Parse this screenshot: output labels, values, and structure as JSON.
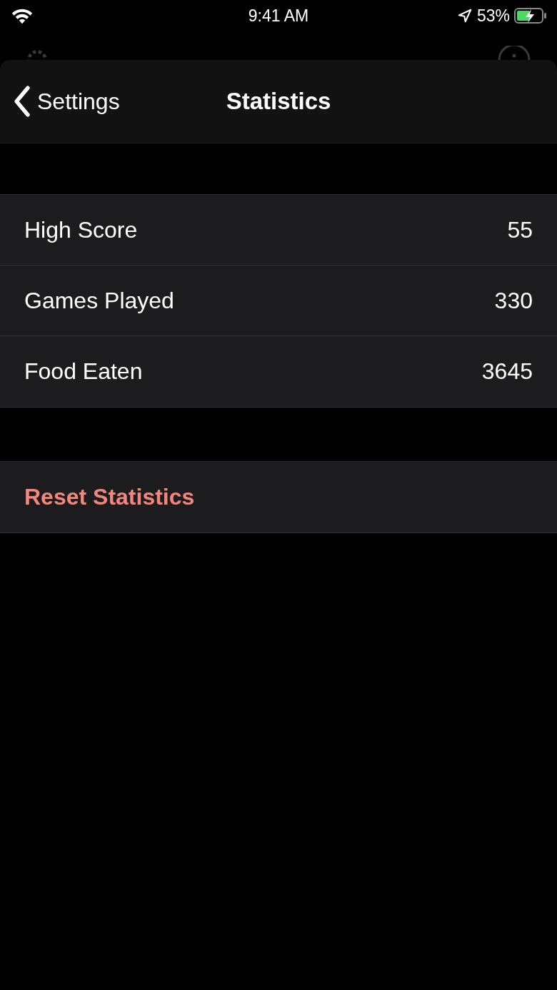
{
  "status_bar": {
    "time": "9:41 AM",
    "battery": "53%"
  },
  "nav_bar": {
    "back": "Settings",
    "title": "Statistics"
  },
  "stats": [
    {
      "label": "High Score",
      "value": "55"
    },
    {
      "label": "Games Played",
      "value": "330"
    },
    {
      "label": "Food Eaten",
      "value": "3645"
    }
  ],
  "actions": [
    {
      "label": "Reset Statistics",
      "kind": "destructive"
    }
  ]
}
